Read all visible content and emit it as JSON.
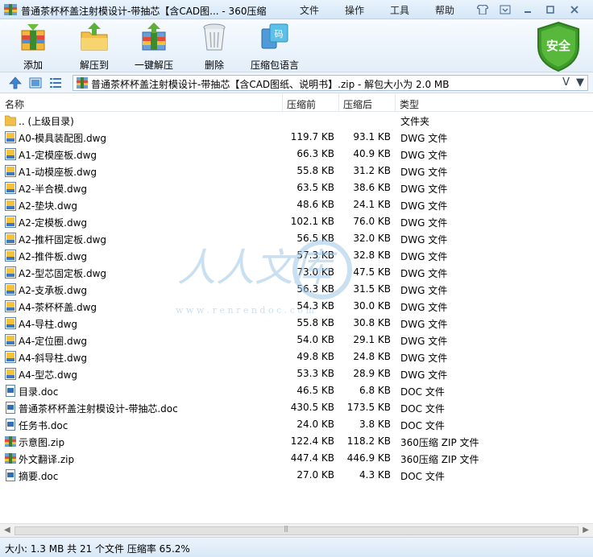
{
  "window": {
    "title": "普通茶杯杯盖注射模设计-带抽芯【含CAD图... - 360压缩",
    "menu": [
      "文件",
      "操作",
      "工具",
      "帮助"
    ]
  },
  "toolbar": {
    "add": "添加",
    "extract_to": "解压到",
    "one_click_extract": "一键解压",
    "delete": "删除",
    "comment": "压缩包语言",
    "safe_badge": "安全"
  },
  "address": {
    "path": "普通茶杯杯盖注射模设计-带抽芯【含CAD图纸、说明书】.zip - 解包大小为 2.0 MB",
    "dropdown": "V"
  },
  "columns": {
    "name": "名称",
    "size": "压缩前",
    "packed": "压缩后",
    "type": "类型"
  },
  "files": [
    {
      "name": ".. (上级目录)",
      "size": "",
      "packed": "",
      "type": "文件夹",
      "icon": "folder"
    },
    {
      "name": "A0-模具装配图.dwg",
      "size": "119.7 KB",
      "packed": "93.1 KB",
      "type": "DWG 文件",
      "icon": "dwg"
    },
    {
      "name": "A1-定模座板.dwg",
      "size": "66.3 KB",
      "packed": "40.9 KB",
      "type": "DWG 文件",
      "icon": "dwg"
    },
    {
      "name": "A1-动模座板.dwg",
      "size": "55.8 KB",
      "packed": "31.2 KB",
      "type": "DWG 文件",
      "icon": "dwg"
    },
    {
      "name": "A2-半合模.dwg",
      "size": "63.5 KB",
      "packed": "38.6 KB",
      "type": "DWG 文件",
      "icon": "dwg"
    },
    {
      "name": "A2-垫块.dwg",
      "size": "48.6 KB",
      "packed": "24.1 KB",
      "type": "DWG 文件",
      "icon": "dwg"
    },
    {
      "name": "A2-定模板.dwg",
      "size": "102.1 KB",
      "packed": "76.0 KB",
      "type": "DWG 文件",
      "icon": "dwg"
    },
    {
      "name": "A2-推杆固定板.dwg",
      "size": "56.5 KB",
      "packed": "32.0 KB",
      "type": "DWG 文件",
      "icon": "dwg"
    },
    {
      "name": "A2-推件板.dwg",
      "size": "57.3 KB",
      "packed": "32.8 KB",
      "type": "DWG 文件",
      "icon": "dwg"
    },
    {
      "name": "A2-型芯固定板.dwg",
      "size": "73.0 KB",
      "packed": "47.5 KB",
      "type": "DWG 文件",
      "icon": "dwg"
    },
    {
      "name": "A2-支承板.dwg",
      "size": "56.3 KB",
      "packed": "31.5 KB",
      "type": "DWG 文件",
      "icon": "dwg"
    },
    {
      "name": "A4-茶杯杯盖.dwg",
      "size": "54.3 KB",
      "packed": "30.0 KB",
      "type": "DWG 文件",
      "icon": "dwg"
    },
    {
      "name": "A4-导柱.dwg",
      "size": "55.8 KB",
      "packed": "30.8 KB",
      "type": "DWG 文件",
      "icon": "dwg"
    },
    {
      "name": "A4-定位圈.dwg",
      "size": "54.0 KB",
      "packed": "29.1 KB",
      "type": "DWG 文件",
      "icon": "dwg"
    },
    {
      "name": "A4-斜导柱.dwg",
      "size": "49.8 KB",
      "packed": "24.8 KB",
      "type": "DWG 文件",
      "icon": "dwg"
    },
    {
      "name": "A4-型芯.dwg",
      "size": "53.3 KB",
      "packed": "28.9 KB",
      "type": "DWG 文件",
      "icon": "dwg"
    },
    {
      "name": "目录.doc",
      "size": "46.5 KB",
      "packed": "6.8 KB",
      "type": "DOC 文件",
      "icon": "doc"
    },
    {
      "name": "普通茶杯杯盖注射模设计-带抽芯.doc",
      "size": "430.5 KB",
      "packed": "173.5 KB",
      "type": "DOC 文件",
      "icon": "doc"
    },
    {
      "name": "任务书.doc",
      "size": "24.0 KB",
      "packed": "3.8 KB",
      "type": "DOC 文件",
      "icon": "doc"
    },
    {
      "name": "示意图.zip",
      "size": "122.4 KB",
      "packed": "118.2 KB",
      "type": "360压缩 ZIP 文件",
      "icon": "zip"
    },
    {
      "name": "外文翻译.zip",
      "size": "447.4 KB",
      "packed": "446.9 KB",
      "type": "360压缩 ZIP 文件",
      "icon": "zip"
    },
    {
      "name": "摘要.doc",
      "size": "27.0 KB",
      "packed": "4.3 KB",
      "type": "DOC 文件",
      "icon": "doc"
    }
  ],
  "watermark": {
    "text": "人人文库",
    "url": "w w w . r e n r e n d o c . c o m"
  },
  "status": {
    "text": "大小: 1.3 MB 共 21 个文件 压缩率 65.2%"
  },
  "colors": {
    "safe_badge": "#4aa832",
    "accent": "#2f6fb5",
    "watermark": "#9cc7e9"
  }
}
